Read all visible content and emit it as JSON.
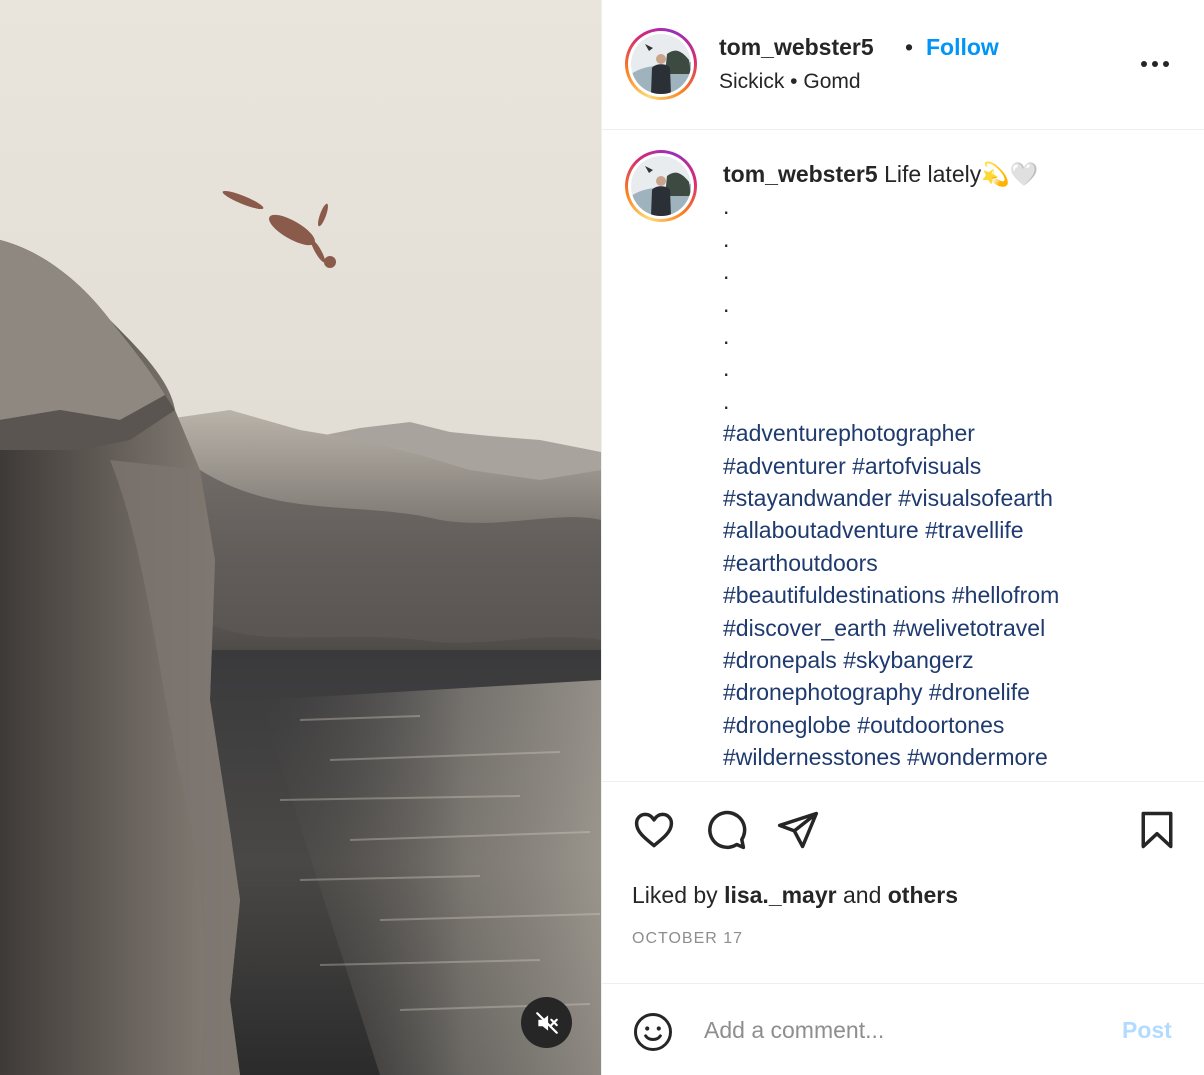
{
  "post": {
    "username": "tom_webster5",
    "follow_label": "Follow",
    "separator": "•",
    "subtitle": "Sickick • Gomd",
    "more_icon": "more-horizontal-icon"
  },
  "caption": {
    "username": "tom_webster5",
    "text": "Life lately💫🤍",
    "dots": [
      ".",
      ".",
      ".",
      ".",
      ".",
      ".",
      "."
    ],
    "hashtag_lines": [
      [
        "#adventurephotographer"
      ],
      [
        "#adventurer",
        "#artofvisuals"
      ],
      [
        "#stayandwander",
        "#visualsofearth"
      ],
      [
        "#allaboutadventure",
        "#travellife"
      ],
      [
        "#earthoutdoors"
      ],
      [
        "#beautifuldestinations",
        "#hellofrom"
      ],
      [
        "#discover_earth",
        "#welivetotravel"
      ],
      [
        "#dronepals",
        "#skybangerz"
      ],
      [
        "#dronephotography",
        "#dronelife"
      ],
      [
        "#droneglobe",
        "#outdoortones"
      ],
      [
        "#wildernesstones",
        "#wondermore"
      ]
    ]
  },
  "actions": {
    "like_icon": "heart-icon",
    "comment_icon": "comment-icon",
    "share_icon": "paper-plane-icon",
    "save_icon": "bookmark-icon"
  },
  "likes": {
    "prefix": "Liked by",
    "user": "lisa._mayr",
    "joiner": "and",
    "others": "others"
  },
  "date": "OCTOBER 17",
  "comment": {
    "emoji_icon": "emoji-smile-icon",
    "placeholder": "Add a comment...",
    "post_label": "Post"
  },
  "media": {
    "mute_icon": "speaker-muted-icon"
  },
  "colors": {
    "follow": "#0095f6",
    "hashtag": "#1e3a6e",
    "post_disabled": "#b3dbff",
    "muted_text": "#8e8e8e"
  }
}
